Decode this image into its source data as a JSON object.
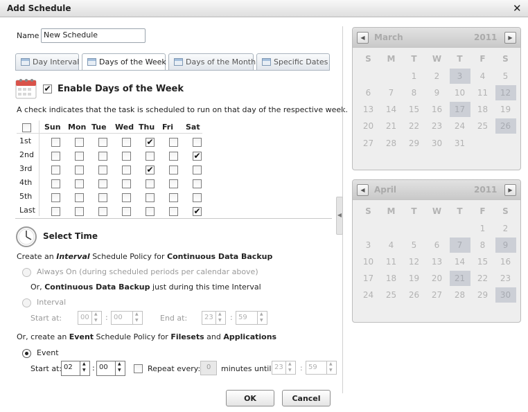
{
  "dialog": {
    "title": "Add Schedule",
    "close_glyph": "✕"
  },
  "name": {
    "label": "Name",
    "value": "New Schedule"
  },
  "tabs": [
    {
      "label": "Day Interval",
      "active": false
    },
    {
      "label": "Days of the Week",
      "active": true
    },
    {
      "label": "Days of the Month",
      "active": false
    },
    {
      "label": "Specific Dates",
      "active": false
    }
  ],
  "week": {
    "enable_label": "Enable Days of the Week",
    "enabled": true,
    "description": "A check indicates that the task is scheduled to run on that day of the respective week.",
    "days": [
      "Sun",
      "Mon",
      "Tue",
      "Wed",
      "Thu",
      "Fri",
      "Sat"
    ],
    "rows": [
      {
        "label": "1st",
        "checks": [
          false,
          false,
          false,
          false,
          true,
          false,
          false
        ]
      },
      {
        "label": "2nd",
        "checks": [
          false,
          false,
          false,
          false,
          false,
          false,
          true
        ]
      },
      {
        "label": "3rd",
        "checks": [
          false,
          false,
          false,
          false,
          true,
          false,
          false
        ]
      },
      {
        "label": "4th",
        "checks": [
          false,
          false,
          false,
          false,
          false,
          false,
          false
        ]
      },
      {
        "label": "5th",
        "checks": [
          false,
          false,
          false,
          false,
          false,
          false,
          false
        ]
      },
      {
        "label": "Last",
        "checks": [
          false,
          false,
          false,
          false,
          false,
          false,
          true
        ]
      }
    ]
  },
  "time": {
    "heading": "Select Time",
    "interval_policy": {
      "p1": "Create an ",
      "p2": "Interval",
      "p3": " Schedule Policy for ",
      "p4": "Continuous Data Backup"
    },
    "always_on": "Always On (during scheduled periods per calendar above)",
    "or_cdb": {
      "p1": "Or, ",
      "p2": "Continuous Data Backup",
      "p3": " just during this time Interval"
    },
    "interval_label": "Interval",
    "start_label": "Start at:",
    "start_h": "00",
    "start_m": "00",
    "end_label": "End at:",
    "end_h": "23",
    "end_m": "59",
    "event_policy": {
      "p1": "Or, create an ",
      "p2": "Event",
      "p3": " Schedule Policy for ",
      "p4": "Filesets",
      "p5": " and ",
      "p6": "Applications"
    },
    "event_label": "Event",
    "event_start_label": "Start at:",
    "event_h": "02",
    "event_m": "00",
    "repeat_label": "Repeat every:",
    "repeat_value": "0",
    "until_label": "minutes until",
    "until_h": "23",
    "until_m": "59",
    "colon": ":"
  },
  "buttons": {
    "ok": "OK",
    "cancel": "Cancel"
  },
  "calendars": [
    {
      "month": "March",
      "year": "2011",
      "dow": [
        "S",
        "M",
        "T",
        "W",
        "T",
        "F",
        "S"
      ],
      "weeks": [
        [
          "",
          "",
          "1",
          "2",
          "3",
          "4",
          "5"
        ],
        [
          "6",
          "7",
          "8",
          "9",
          "10",
          "11",
          "12"
        ],
        [
          "13",
          "14",
          "15",
          "16",
          "17",
          "18",
          "19"
        ],
        [
          "20",
          "21",
          "22",
          "23",
          "24",
          "25",
          "26"
        ],
        [
          "27",
          "28",
          "29",
          "30",
          "31",
          "",
          ""
        ]
      ],
      "highlighted": [
        "3",
        "12",
        "17",
        "26"
      ]
    },
    {
      "month": "April",
      "year": "2011",
      "dow": [
        "S",
        "M",
        "T",
        "W",
        "T",
        "F",
        "S"
      ],
      "weeks": [
        [
          "",
          "",
          "",
          "",
          "",
          "1",
          "2"
        ],
        [
          "3",
          "4",
          "5",
          "6",
          "7",
          "8",
          "9"
        ],
        [
          "10",
          "11",
          "12",
          "13",
          "14",
          "15",
          "16"
        ],
        [
          "17",
          "18",
          "19",
          "20",
          "21",
          "22",
          "23"
        ],
        [
          "24",
          "25",
          "26",
          "27",
          "28",
          "29",
          "30"
        ]
      ],
      "highlighted": [
        "7",
        "9",
        "21",
        "30"
      ]
    }
  ]
}
